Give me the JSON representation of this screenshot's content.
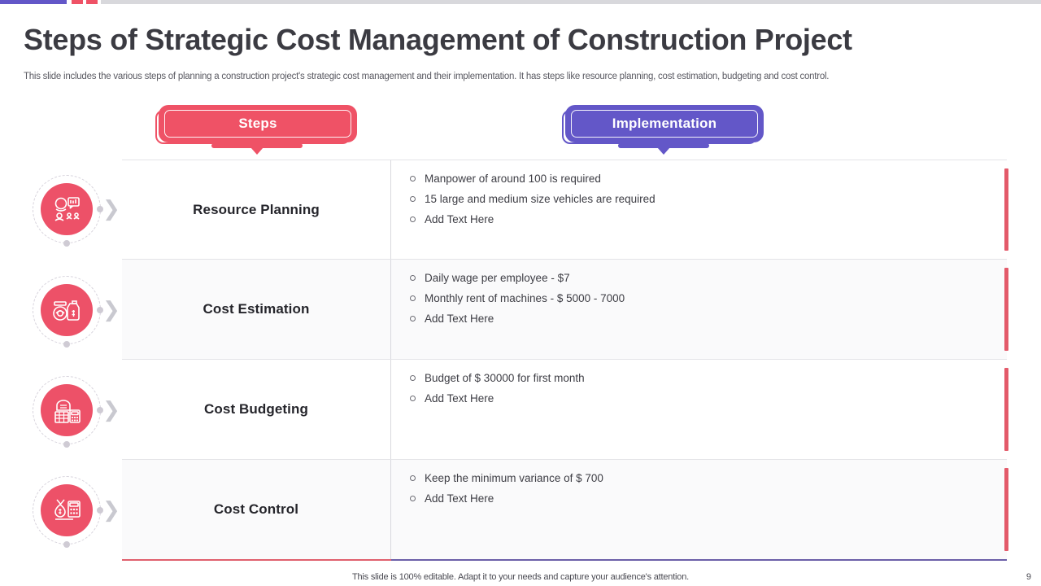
{
  "slide": {
    "title": "Steps of Strategic Cost Management of Construction Project",
    "subtitle": "This slide includes the various steps of planning a construction project's strategic cost management and their implementation. It has steps like resource planning, cost estimation, budgeting and cost control.",
    "footer_note": "This slide is 100% editable. Adapt it to your needs and capture your audience's attention.",
    "page_number": "9"
  },
  "colors": {
    "red": "#ef5266",
    "purple": "#6357c8",
    "accent_bar": "#e35a6a",
    "title_text": "#3b3b42",
    "body_text": "#3d3d44"
  },
  "headers": {
    "steps_label": "Steps",
    "implementation_label": "Implementation"
  },
  "rows": [
    {
      "step": "Resource Planning",
      "icon": "resource-planning-icon",
      "chevron": "❯",
      "bullets": [
        "Manpower of around 100 is required",
        "15 large and medium size vehicles are required",
        "Add Text Here"
      ]
    },
    {
      "step": "Cost Estimation",
      "icon": "cost-estimation-icon",
      "chevron": "❯",
      "bullets": [
        "Daily wage per employee - $7",
        "Monthly  rent of machines - $ 5000 - 7000",
        "Add Text Here"
      ]
    },
    {
      "step": "Cost Budgeting",
      "icon": "cost-budgeting-icon",
      "chevron": "❯",
      "bullets": [
        "Budget of $ 30000 for first month",
        "Add Text Here"
      ]
    },
    {
      "step": "Cost Control",
      "icon": "cost-control-icon",
      "chevron": "❯",
      "bullets": [
        "Keep the minimum variance of $ 700",
        "Add Text Here"
      ]
    }
  ]
}
